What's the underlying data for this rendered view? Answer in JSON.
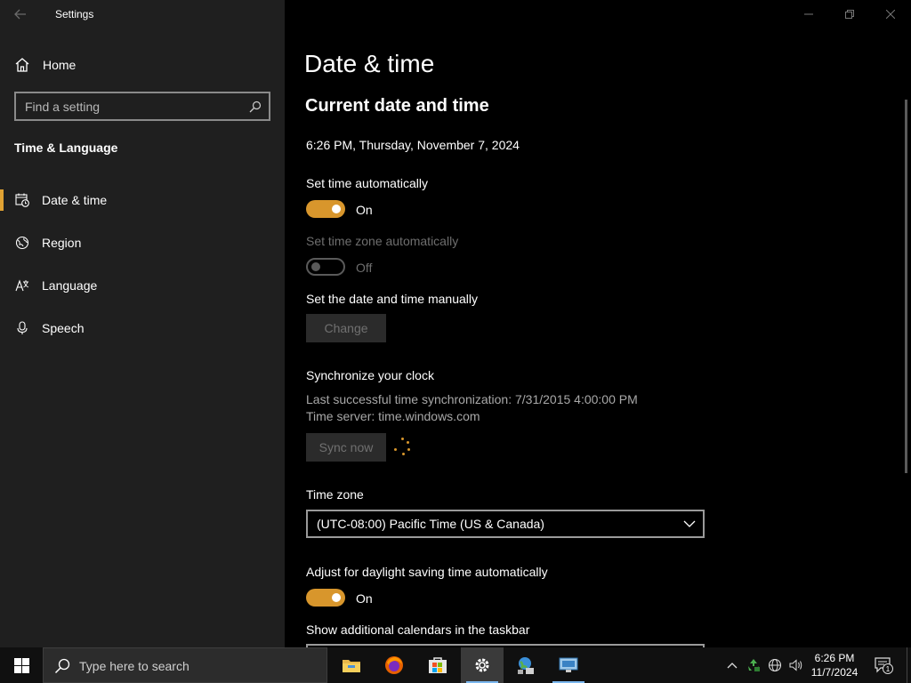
{
  "window": {
    "title": "Settings",
    "controls": {
      "minimize": "—",
      "restore": "❐",
      "close": "✕"
    }
  },
  "nav": {
    "home_label": "Home",
    "search_placeholder": "Find a setting",
    "section_title": "Time & Language",
    "items": [
      {
        "label": "Date & time",
        "icon": "calendar-clock-icon",
        "active": true
      },
      {
        "label": "Region",
        "icon": "globe-icon",
        "active": false
      },
      {
        "label": "Language",
        "icon": "language-icon",
        "active": false
      },
      {
        "label": "Speech",
        "icon": "microphone-icon",
        "active": false
      }
    ]
  },
  "main": {
    "page_title": "Date & time",
    "subtitle": "Current date and time",
    "current_datetime": "6:26 PM, Thursday, November 7, 2024",
    "set_time_auto": {
      "label": "Set time automatically",
      "state": "On",
      "on": true
    },
    "set_tz_auto": {
      "label": "Set time zone automatically",
      "state": "Off",
      "on": false,
      "disabled": true
    },
    "manual": {
      "label": "Set the date and time manually",
      "button": "Change"
    },
    "sync": {
      "label": "Synchronize your clock",
      "last_sync": "Last successful time synchronization: 7/31/2015 4:00:00 PM",
      "server": "Time server: time.windows.com",
      "button": "Sync now"
    },
    "timezone": {
      "label": "Time zone",
      "value": "(UTC-08:00) Pacific Time (US & Canada)"
    },
    "dst": {
      "label": "Adjust for daylight saving time automatically",
      "state": "On",
      "on": true
    },
    "calendars": {
      "label": "Show additional calendars in the taskbar"
    }
  },
  "taskbar": {
    "search_placeholder": "Type here to search",
    "apps": [
      "file-explorer-icon",
      "firefox-icon",
      "store-icon",
      "settings-icon",
      "network-app-icon",
      "remote-desktop-icon"
    ],
    "clock_time": "6:26 PM",
    "clock_date": "11/7/2024",
    "notification_count": "1"
  },
  "colors": {
    "accent": "#d8962c",
    "nav_bg": "#1f1f1f",
    "main_bg": "#000000"
  }
}
